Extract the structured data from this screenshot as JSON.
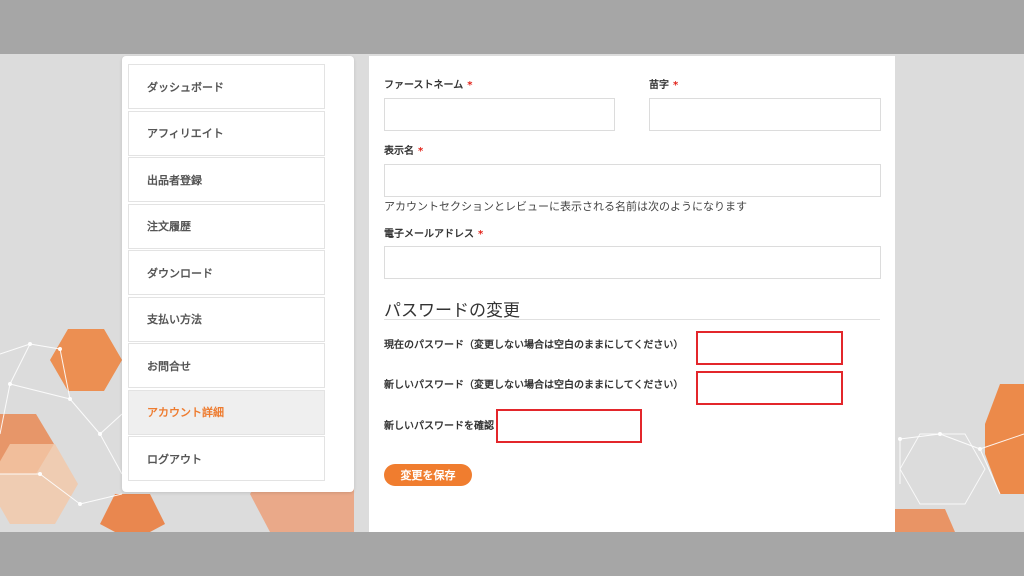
{
  "nav": {
    "items": [
      {
        "label": "ダッシュボード"
      },
      {
        "label": "アフィリエイト"
      },
      {
        "label": "出品者登録"
      },
      {
        "label": "注文履歴"
      },
      {
        "label": "ダウンロード"
      },
      {
        "label": "支払い方法"
      },
      {
        "label": "お問合せ"
      },
      {
        "label": "アカウント詳細",
        "active": true
      },
      {
        "label": "ログアウト"
      }
    ]
  },
  "form": {
    "required_mark": "*",
    "first_name": {
      "label": "ファーストネーム",
      "value": ""
    },
    "last_name": {
      "label": "苗字",
      "value": ""
    },
    "display_name": {
      "label": "表示名",
      "value": "",
      "help": "アカウントセクションとレビューに表示される名前は次のようになります"
    },
    "email": {
      "label": "電子メールアドレス",
      "value": ""
    },
    "password_section": {
      "title": "パスワードの変更",
      "current": {
        "label": "現在のパスワード（変更しない場合は空白のままにしてください）",
        "value": ""
      },
      "new": {
        "label": "新しいパスワード（変更しない場合は空白のままにしてください）",
        "value": ""
      },
      "confirm": {
        "label": "新しいパスワードを確認",
        "value": ""
      }
    },
    "save_label": "変更を保存"
  },
  "colors": {
    "accent": "#f07d2f",
    "active_nav_text": "#ee7c30",
    "required": "#e2231a",
    "highlight_border": "#e3262b"
  }
}
